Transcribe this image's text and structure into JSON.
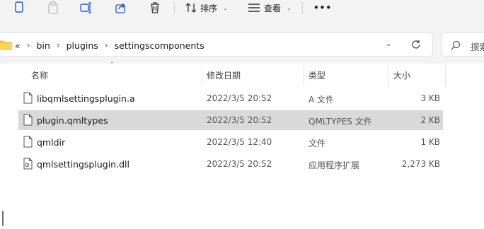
{
  "toolbar": {
    "sort_label": "排序",
    "view_label": "查看",
    "more_label": "•••"
  },
  "address": {
    "crumbs": [
      "«",
      "bin",
      "plugins",
      "settingscomponents"
    ],
    "search_placeholder": "搜索"
  },
  "columns": {
    "name": "名称",
    "date": "修改日期",
    "type": "类型",
    "size": "大小"
  },
  "files": [
    {
      "name": "libqmlsettingsplugin.a",
      "date": "2022/3/5 20:52",
      "type": "A 文件",
      "size": "3 KB",
      "icon": "file-icon",
      "selected": false
    },
    {
      "name": "plugin.qmltypes",
      "date": "2022/3/5 20:52",
      "type": "QMLTYPES 文件",
      "size": "2 KB",
      "icon": "file-icon",
      "selected": true
    },
    {
      "name": "qmldir",
      "date": "2022/3/5 12:40",
      "type": "文件",
      "size": "1 KB",
      "icon": "file-icon",
      "selected": false
    },
    {
      "name": "qmlsettingsplugin.dll",
      "date": "2022/3/5 20:52",
      "type": "应用程序扩展",
      "size": "2,273 KB",
      "icon": "dll-file-icon",
      "selected": false
    }
  ],
  "colors": {
    "selection": "#d9d9d9",
    "toolbar_bg": "#f3f3f3",
    "folder": "#f4c03f"
  }
}
